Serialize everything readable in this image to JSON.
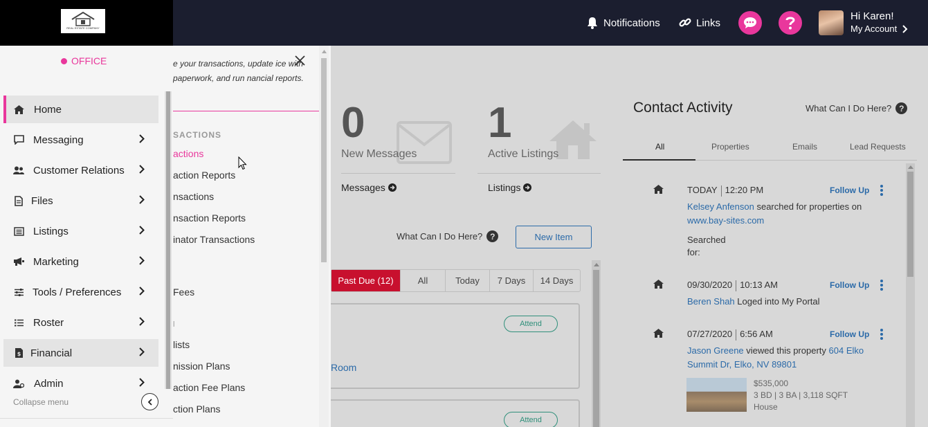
{
  "topbar": {
    "logo_text": "REAL ESTATE COMPANY",
    "notifications": "Notifications",
    "links": "Links",
    "account_greeting": "Hi Karen!",
    "account_label": "My Account"
  },
  "sidebar": {
    "section": "OFFICE",
    "items": [
      {
        "label": "Home",
        "icon": "home-icon"
      },
      {
        "label": "Messaging",
        "icon": "chat-icon"
      },
      {
        "label": "Customer Relations",
        "icon": "users-icon"
      },
      {
        "label": "Files",
        "icon": "file-icon"
      },
      {
        "label": "Listings",
        "icon": "list-icon"
      },
      {
        "label": "Marketing",
        "icon": "megaphone-icon"
      },
      {
        "label": "Tools / Preferences",
        "icon": "sliders-icon"
      },
      {
        "label": "Roster",
        "icon": "roster-icon"
      },
      {
        "label": "Financial",
        "icon": "dollar-doc-icon"
      },
      {
        "label": "Admin",
        "icon": "admin-icon"
      }
    ],
    "collapse_label": "Collapse menu"
  },
  "flyout": {
    "description": "e your transactions, update ice with paperwork, and run nancial reports.",
    "heading": "SACTIONS",
    "items": [
      "actions",
      "action Reports",
      "nsactions",
      "nsaction Reports",
      "inator Transactions",
      "Fees",
      "l",
      "lists",
      "nission Plans",
      "action Fee Plans",
      "ction Plans"
    ]
  },
  "stats": {
    "messages_count": "0",
    "messages_label": "New Messages",
    "messages_link": "Messages",
    "listings_count": "1",
    "listings_label": "Active Listings",
    "listings_link": "Listings"
  },
  "tasks": {
    "help": "What Can I Do Here?",
    "new_item": "New Item",
    "filters": [
      "Past Due (12)",
      "All",
      "Today",
      "7 Days",
      "14 Days"
    ],
    "attend": "Attend",
    "room": "Room"
  },
  "contact_activity": {
    "title": "Contact Activity",
    "help": "What Can I Do Here?",
    "tabs": [
      "All",
      "Properties",
      "Emails",
      "Lead Requests"
    ],
    "follow_up": "Follow Up",
    "entries": [
      {
        "day": "TODAY",
        "time": "12:20 PM",
        "name": "Kelsey Anfenson",
        "action": " searched for properties on",
        "link": "www.bay-sites.com",
        "extra1": "Searched",
        "extra2": "for:"
      },
      {
        "day": "09/30/2020",
        "time": "10:13 AM",
        "name": "Beren Shah",
        "action": " Loged into My Portal"
      },
      {
        "day": "07/27/2020",
        "time": "6:56 AM",
        "name": "Jason Greene",
        "action": " viewed this property ",
        "link": "604 Elko",
        "link2": "Summit Dr, Elko, NV 89801",
        "price": "$535,000",
        "specs": "3 BD | 3 BA | 3,118 SQFT",
        "type": "House"
      }
    ]
  }
}
